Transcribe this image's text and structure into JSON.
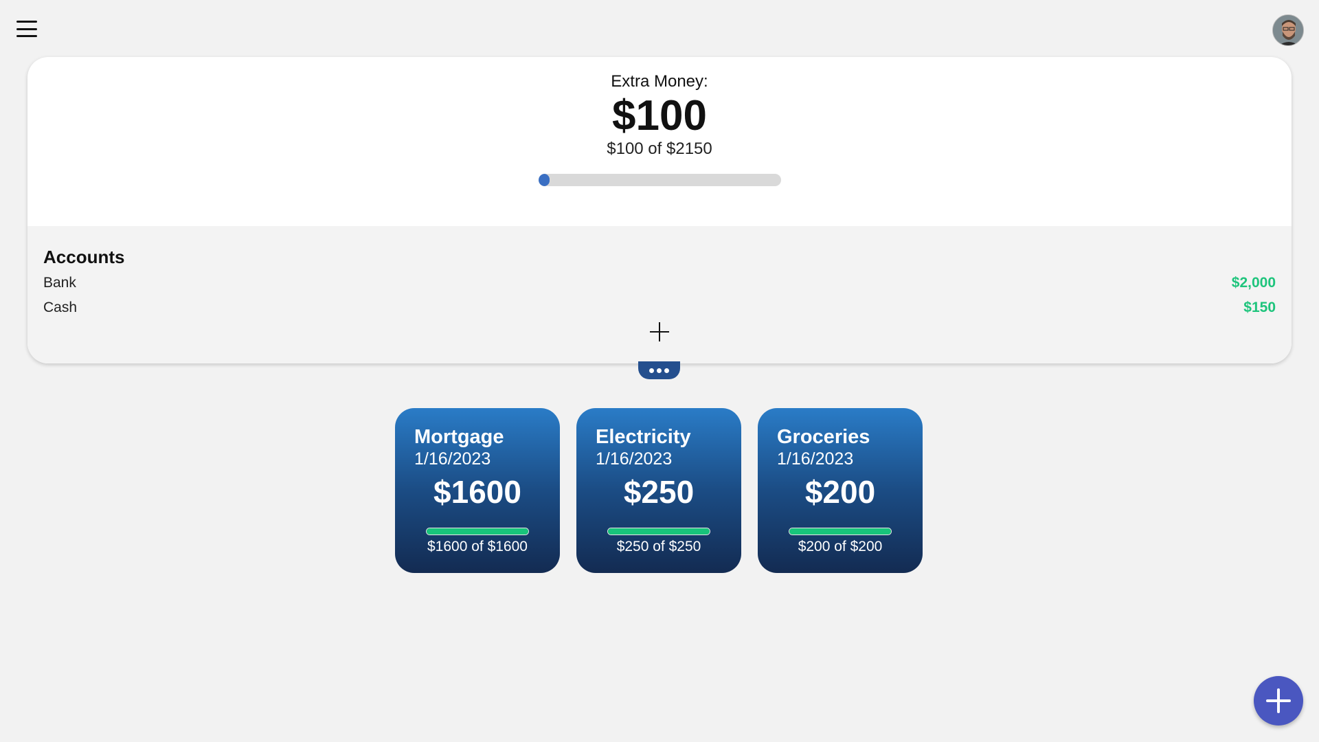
{
  "header": {
    "menu_icon": "hamburger-menu-icon",
    "avatar_icon": "user-avatar"
  },
  "summary": {
    "label": "Extra Money:",
    "amount": "$100",
    "progress_text": "$100 of $2150",
    "progress_fraction": 0.0465,
    "accent": "#3a6fc3"
  },
  "accounts": {
    "title": "Accounts",
    "items": [
      {
        "name": "Bank",
        "value": "$2,000"
      },
      {
        "name": "Cash",
        "value": "$150"
      }
    ],
    "add_icon": "plus-icon",
    "value_color": "#1ec47c"
  },
  "more_icon": "ellipsis-icon",
  "bills": [
    {
      "name": "Mortgage",
      "date": "1/16/2023",
      "amount": "$1600",
      "progress_text": "$1600 of $1600",
      "progress_fraction": 1.0
    },
    {
      "name": "Electricity",
      "date": "1/16/2023",
      "amount": "$250",
      "progress_text": "$250 of $250",
      "progress_fraction": 1.0
    },
    {
      "name": "Groceries",
      "date": "1/16/2023",
      "amount": "$200",
      "progress_text": "$200 of $200",
      "progress_fraction": 1.0
    }
  ],
  "fab_icon": "plus-icon",
  "colors": {
    "card_gradient_top": "#2a7cc7",
    "card_gradient_bottom": "#132b52",
    "bill_progress": "#18c47b",
    "fab": "#4a57c0"
  }
}
